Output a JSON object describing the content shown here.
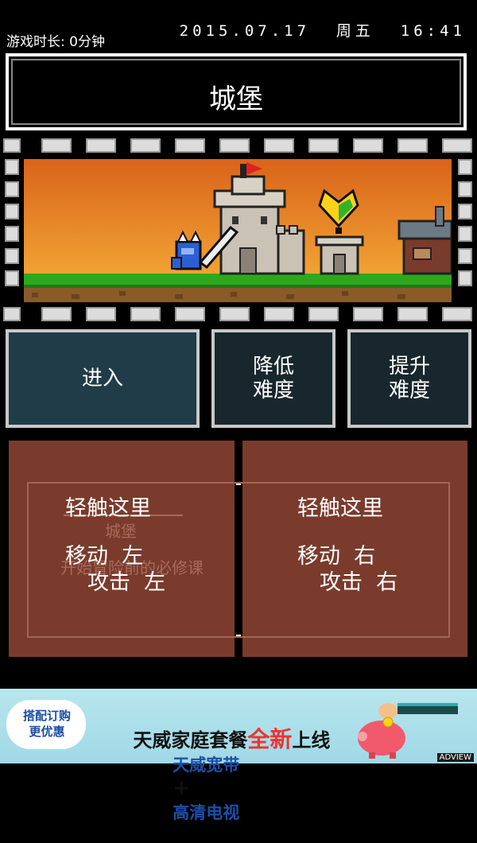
{
  "status": {
    "playtime": "游戏时长: 0分钟",
    "datetime": "2015.07.17  周五  16:41"
  },
  "title": "城堡",
  "scene": {
    "sky_top": "#d9631a",
    "sky_bottom": "#f7b23a",
    "grass": "#2da81d",
    "dirt": "#8a5a2a",
    "icons": [
      "castle-icon",
      "knight-icon",
      "heart-shield-icon",
      "small-tower-icon",
      "shop-house-icon"
    ]
  },
  "buttons": {
    "enter": "进入",
    "easier": "降低\n难度",
    "harder": "提升\n难度"
  },
  "panels": {
    "left": {
      "line1": "轻触这里",
      "line2": "移动  左",
      "line3": "攻击  左"
    },
    "right": {
      "line1": "轻触这里",
      "line2": "移动  右",
      "line3": "攻击  右"
    },
    "ghost_title": "城堡",
    "ghost_sub": "开始冒险前的必修课"
  },
  "ad": {
    "badge": "搭配订购\n更优惠",
    "headline_a": "天威家庭套餐",
    "headline_b": "全新",
    "headline_c": "上线",
    "sub_a": "天威宽带",
    "sub_plus": "+",
    "sub_b": "高清电视",
    "brand": "ADVIEW"
  }
}
